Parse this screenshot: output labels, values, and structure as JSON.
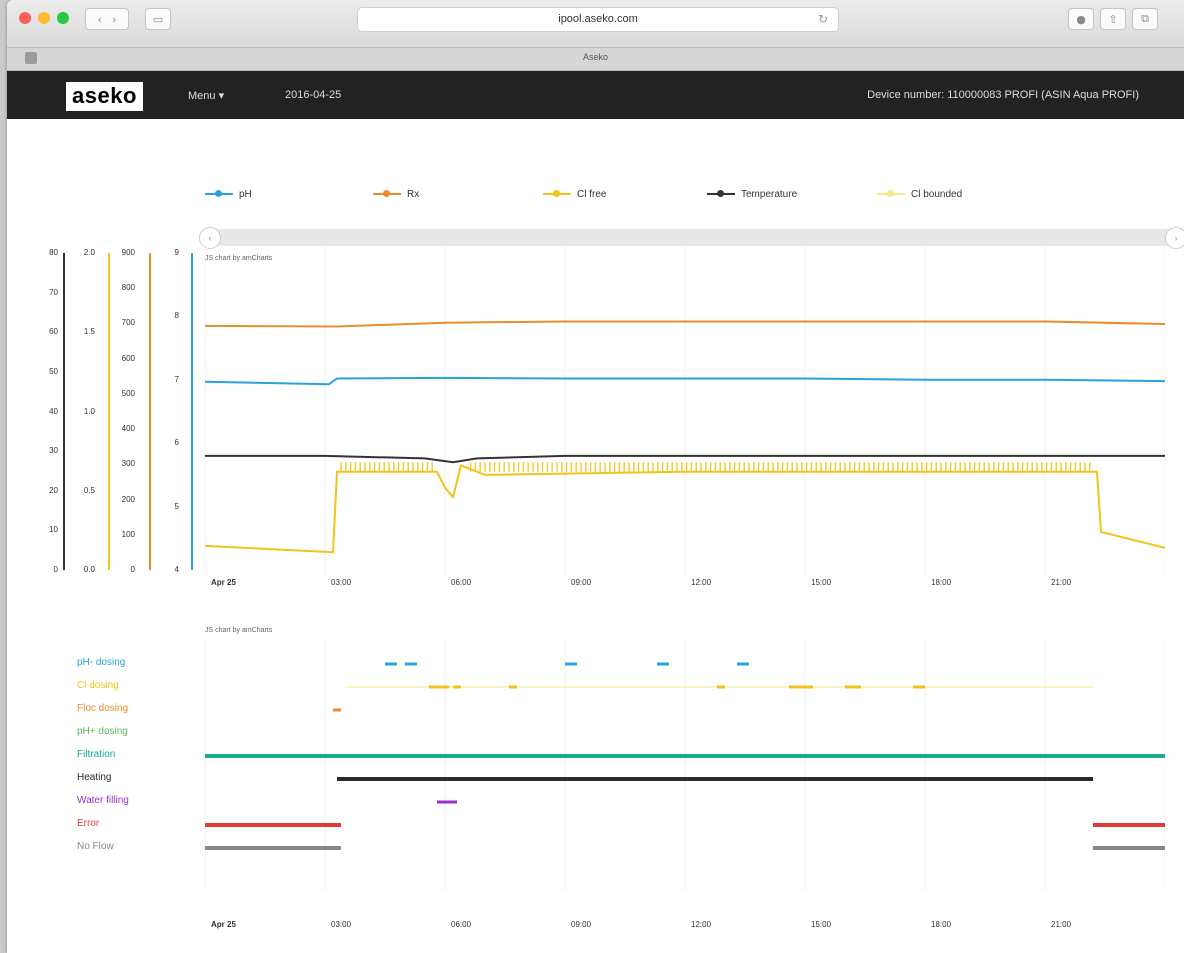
{
  "browser": {
    "url": "ipool.aseko.com",
    "tab_title": "Aseko"
  },
  "header": {
    "logo": "aseko",
    "menu_label": "Menu ▾",
    "date": "2016-04-25",
    "device": "Device number: 110000083 PROFI (ASIN Aqua PROFI)"
  },
  "colors": {
    "ph": "#29a3d9",
    "rx": "#e88c2e",
    "cl_free": "#f0c419",
    "temperature": "#333333",
    "cl_bounded": "#f5e88a",
    "filtration": "#1aaa8f",
    "heating": "#2b2b2b",
    "water_filling": "#9b30c8",
    "error": "#e03b3b",
    "no_flow": "#888888",
    "floc": "#e88c2e",
    "ph_plus": "#5cb85c"
  },
  "legend": [
    {
      "label": "pH",
      "color": "#29a3d9"
    },
    {
      "label": "Rx",
      "color": "#e88c2e"
    },
    {
      "label": "Cl free",
      "color": "#f0c419"
    },
    {
      "label": "Temperature",
      "color": "#333333"
    },
    {
      "label": "Cl bounded",
      "color": "#f5e88a"
    }
  ],
  "axes": {
    "temp": [
      "80",
      "70",
      "60",
      "50",
      "40",
      "30",
      "20",
      "10",
      "0"
    ],
    "cl": [
      "2.0",
      "1.5",
      "1.0",
      "0.5",
      "0.0"
    ],
    "rx": [
      "900",
      "800",
      "700",
      "600",
      "500",
      "400",
      "300",
      "200",
      "100",
      "0"
    ],
    "ph": [
      "9",
      "8",
      "7",
      "6",
      "5",
      "4"
    ]
  },
  "credits": {
    "main": "JS chart by amCharts",
    "events": "JS chart by amCharts"
  },
  "time_ticks": [
    "Apr 25",
    "03:00",
    "06:00",
    "09:00",
    "12:00",
    "15:00",
    "18:00",
    "21:00"
  ],
  "event_labels": [
    {
      "label": "pH- dosing",
      "color": "#29a3d9"
    },
    {
      "label": "Cl dosing",
      "color": "#f0c419"
    },
    {
      "label": "Floc dosing",
      "color": "#e88c2e"
    },
    {
      "label": "pH+ dosing",
      "color": "#5cb85c"
    },
    {
      "label": "Filtration",
      "color": "#1aaa8f"
    },
    {
      "label": "Heating",
      "color": "#2b2b2b"
    },
    {
      "label": "Water filling",
      "color": "#9b30c8"
    },
    {
      "label": "Error",
      "color": "#e03b3b"
    },
    {
      "label": "No Flow",
      "color": "#888888"
    }
  ],
  "chart_data": {
    "type": "line",
    "x_range_hours": [
      0,
      24
    ],
    "ph_axis": [
      4,
      9
    ],
    "series": [
      {
        "name": "pH",
        "axis": "ph",
        "points": [
          [
            0,
            6.97
          ],
          [
            3.1,
            6.93
          ],
          [
            3.3,
            7.02
          ],
          [
            6,
            7.03
          ],
          [
            9,
            7.02
          ],
          [
            12,
            7.02
          ],
          [
            15,
            7.02
          ],
          [
            18,
            7.0
          ],
          [
            21,
            7.0
          ],
          [
            24,
            6.98
          ]
        ]
      },
      {
        "name": "Rx",
        "axis": "ph",
        "points": [
          [
            0,
            7.85
          ],
          [
            3.3,
            7.84
          ],
          [
            6,
            7.9
          ],
          [
            9,
            7.92
          ],
          [
            12,
            7.92
          ],
          [
            15,
            7.92
          ],
          [
            18,
            7.92
          ],
          [
            21,
            7.92
          ],
          [
            24,
            7.88
          ]
        ]
      },
      {
        "name": "Temperature",
        "axis": "ph",
        "points": [
          [
            0,
            5.8
          ],
          [
            3,
            5.8
          ],
          [
            5.5,
            5.76
          ],
          [
            6.2,
            5.7
          ],
          [
            6.8,
            5.76
          ],
          [
            9,
            5.8
          ],
          [
            12,
            5.8
          ],
          [
            15,
            5.8
          ],
          [
            18,
            5.8
          ],
          [
            21,
            5.8
          ],
          [
            24,
            5.8
          ]
        ]
      },
      {
        "name": "Cl free",
        "axis": "ph",
        "points": [
          [
            0,
            4.38
          ],
          [
            3.2,
            4.28
          ],
          [
            3.3,
            5.55
          ],
          [
            5.8,
            5.55
          ],
          [
            6.0,
            5.3
          ],
          [
            6.2,
            5.15
          ],
          [
            6.4,
            5.65
          ],
          [
            7,
            5.5
          ],
          [
            12,
            5.55
          ],
          [
            18,
            5.55
          ],
          [
            22.3,
            5.55
          ],
          [
            22.4,
            4.6
          ],
          [
            24,
            4.35
          ]
        ]
      }
    ],
    "events": [
      {
        "name": "pH- dosing",
        "segments": [
          [
            4.5,
            4.8
          ],
          [
            5.0,
            5.3
          ],
          [
            9.0,
            9.3
          ],
          [
            11.3,
            11.6
          ],
          [
            13.3,
            13.6
          ]
        ]
      },
      {
        "name": "Cl dosing",
        "segments": [
          [
            5.6,
            6.1
          ],
          [
            6.2,
            6.4
          ],
          [
            7.6,
            7.8
          ],
          [
            12.8,
            13.0
          ],
          [
            14.6,
            15.2
          ],
          [
            16.0,
            16.4
          ],
          [
            17.7,
            18.0
          ]
        ]
      },
      {
        "name": "Floc dosing",
        "segments": [
          [
            3.2,
            3.4
          ]
        ]
      },
      {
        "name": "pH+ dosing",
        "segments": []
      },
      {
        "name": "Filtration",
        "segments": [
          [
            0,
            24
          ]
        ]
      },
      {
        "name": "Heating",
        "segments": [
          [
            3.3,
            22.2
          ]
        ]
      },
      {
        "name": "Water filling",
        "segments": [
          [
            5.8,
            6.3
          ]
        ]
      },
      {
        "name": "Error",
        "segments": [
          [
            0,
            3.4
          ],
          [
            22.2,
            24
          ]
        ]
      },
      {
        "name": "No Flow",
        "segments": [
          [
            0,
            3.4
          ],
          [
            22.2,
            24
          ]
        ]
      }
    ]
  }
}
